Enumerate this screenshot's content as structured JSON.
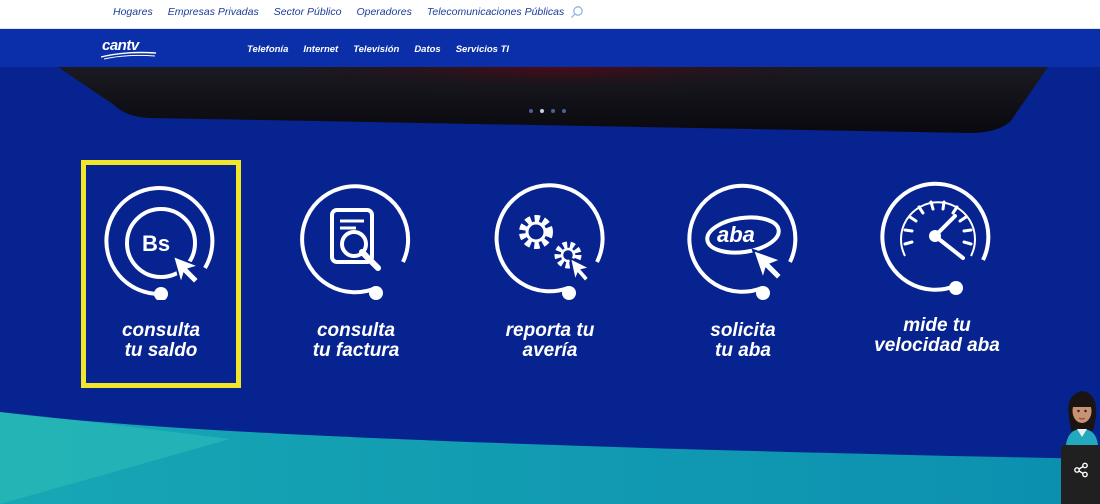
{
  "topbar": {
    "links": [
      "Hogares",
      "Empresas Privadas",
      "Sector Público",
      "Operadores",
      "Telecomunicaciones Públicas"
    ],
    "search_icon": "search-icon"
  },
  "logo": "cantv",
  "navbar": {
    "items": [
      "Telefonía",
      "Internet",
      "Televisión",
      "Datos",
      "Servicios TI"
    ]
  },
  "carousel": {
    "slides": 4,
    "active_slide": 2
  },
  "services": [
    {
      "line1": "consulta",
      "line2": "tu saldo",
      "icon": "bs-cursor-icon",
      "selected": true
    },
    {
      "line1": "consulta",
      "line2": "tu factura",
      "icon": "invoice-search-icon",
      "selected": false
    },
    {
      "line1": "reporta tu",
      "line2": "avería",
      "icon": "gears-cursor-icon",
      "selected": false
    },
    {
      "line1": "solicita",
      "line2": "tu aba",
      "icon": "aba-cursor-icon",
      "selected": false
    },
    {
      "line1": "mide tu",
      "line2": "velocidad aba",
      "icon": "speedometer-icon",
      "selected": false
    }
  ],
  "colors": {
    "background": "#06238f",
    "navbar": "#0a2fa8",
    "selection": "#f2e62a",
    "teal_wave": "#0f9fb2"
  }
}
